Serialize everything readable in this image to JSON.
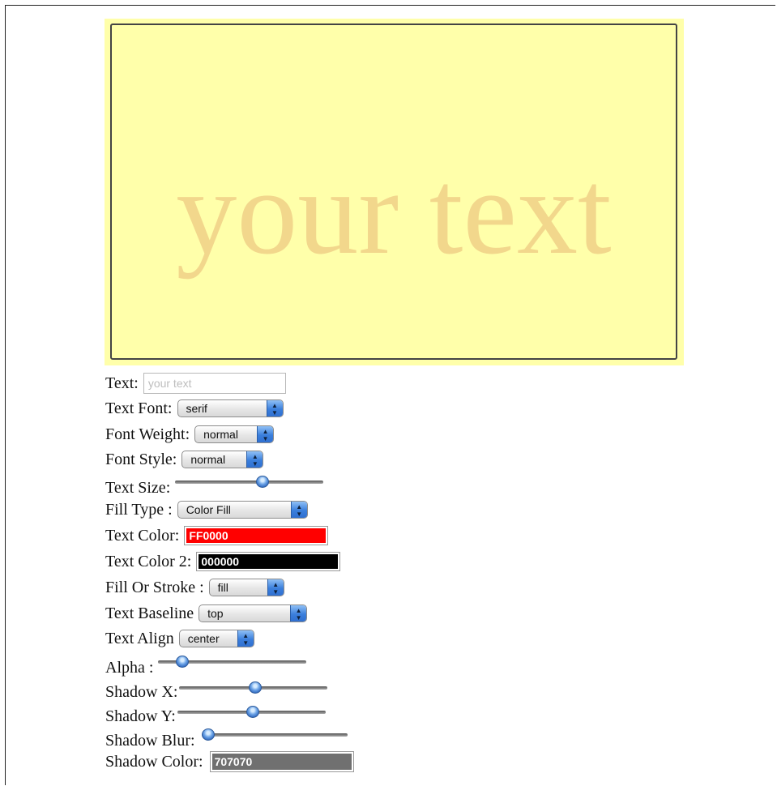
{
  "canvas": {
    "text": "your text",
    "background_color": "#ffffaa",
    "text_color": "#f2d78c"
  },
  "controls": {
    "text": {
      "label": "Text:",
      "value": "",
      "placeholder": "your text"
    },
    "text_font": {
      "label": "Text Font:",
      "value": "serif"
    },
    "font_weight": {
      "label": "Font Weight:",
      "value": "normal"
    },
    "font_style": {
      "label": "Font Style:",
      "value": "normal"
    },
    "text_size": {
      "label": "Text Size:",
      "fraction": 0.6
    },
    "fill_type": {
      "label": "Fill Type :",
      "value": "Color Fill"
    },
    "text_color": {
      "label": "Text Color:",
      "value": "FF0000",
      "color": "#ff0000"
    },
    "text_color_2": {
      "label": "Text Color 2:",
      "value": "000000",
      "color": "#000000"
    },
    "fill_or_stroke": {
      "label": "Fill Or Stroke :",
      "value": "fill"
    },
    "text_baseline": {
      "label": "Text Baseline",
      "value": "top"
    },
    "text_align": {
      "label": "Text Align",
      "value": "center"
    },
    "alpha": {
      "label": "Alpha :",
      "fraction": 0.13
    },
    "shadow_x": {
      "label": "Shadow X:",
      "fraction": 0.51
    },
    "shadow_y": {
      "label": "Shadow Y:",
      "fraction": 0.51
    },
    "shadow_blur": {
      "label": "Shadow Blur:",
      "fraction": 0.0
    },
    "shadow_color": {
      "label": "Shadow Color:",
      "value": "707070",
      "color": "#707070"
    }
  }
}
